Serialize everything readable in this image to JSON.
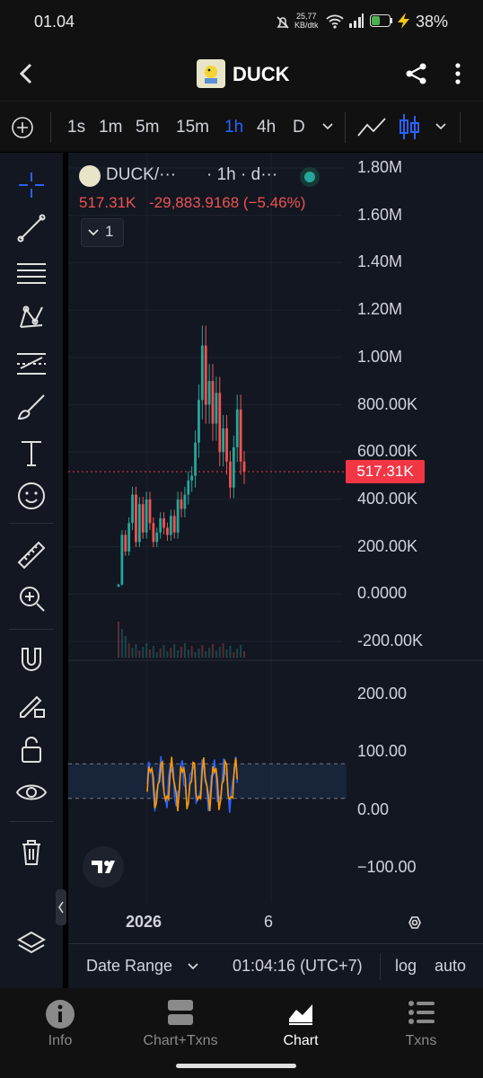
{
  "status": {
    "time": "01.04",
    "speed_value": "25,77",
    "speed_unit": "KB/dtk",
    "battery": "38%"
  },
  "header": {
    "title": "DUCK"
  },
  "toolbar": {
    "timeframes": [
      "1s",
      "1m",
      "5m",
      "15m",
      "1h",
      "4h",
      "D"
    ],
    "active_timeframe": "1h"
  },
  "legend": {
    "symbol": "DUCK/···",
    "interval": "· 1h · d···",
    "price": "517.31K",
    "change": "-29,883.9168 (−5.46%)",
    "collapse_count": "1"
  },
  "price_axis": {
    "labels": [
      "1.80M",
      "1.60M",
      "1.40M",
      "1.20M",
      "1.00M",
      "800.00K",
      "600.00K",
      "400.00K",
      "200.00K",
      "0.0000",
      "-200.00K"
    ],
    "current_price": "517.31K"
  },
  "indicator_axis": {
    "labels": [
      "200.00",
      "100.00",
      "0.00",
      "−100.00"
    ]
  },
  "time_axis": {
    "labels": [
      "2026",
      "6"
    ]
  },
  "bottom": {
    "date_range": "Date Range",
    "clock": "01:04:16 (UTC+7)",
    "log": "log",
    "auto": "auto"
  },
  "nav": {
    "items": [
      "Info",
      "Chart+Txns",
      "Chart",
      "Txns"
    ],
    "active": "Chart"
  },
  "colors": {
    "up": "#26a69a",
    "down": "#ef5350",
    "accent": "#2962ff",
    "price_tag": "#f23645"
  },
  "chart_data": {
    "type": "candlestick",
    "price_axis_range": [
      -200000,
      1800000
    ],
    "price_line": 517310,
    "candles_approx_close": [
      40000,
      250000,
      180000,
      300000,
      420000,
      220000,
      380000,
      260000,
      400000,
      300000,
      220000,
      260000,
      320000,
      280000,
      250000,
      330000,
      260000,
      400000,
      360000,
      420000,
      480000,
      500000,
      640000,
      820000,
      1050000,
      800000,
      900000,
      720000,
      850000,
      600000,
      700000,
      560000,
      450000,
      620000,
      780000,
      560000,
      517310
    ],
    "indicator_range": [
      -100,
      200
    ],
    "indicator_band": [
      20,
      80
    ]
  }
}
